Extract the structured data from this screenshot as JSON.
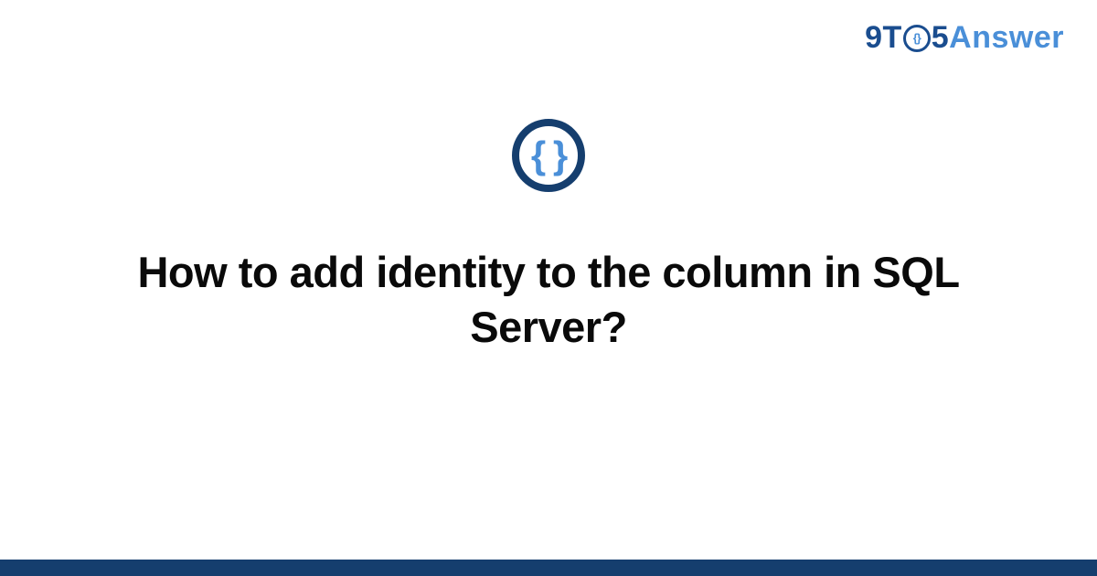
{
  "logo": {
    "part1": "9T",
    "innerBraces": "{}",
    "part2": "5",
    "part3": "Answer"
  },
  "icon": {
    "braces": "{ }"
  },
  "question": "How to add identity to the column in SQL Server?"
}
